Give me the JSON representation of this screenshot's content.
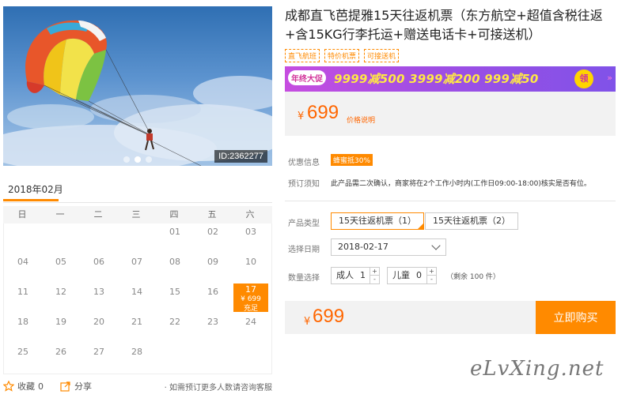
{
  "photo": {
    "id_tag": "ID:2362277",
    "carousel_count": 3,
    "carousel_active": 2
  },
  "calendar": {
    "month": "2018年02月",
    "weekdays": [
      "日",
      "一",
      "二",
      "三",
      "四",
      "五",
      "六"
    ],
    "rows": [
      [
        "",
        "",
        "",
        "",
        "01",
        "02",
        "03"
      ],
      [
        "04",
        "05",
        "06",
        "07",
        "08",
        "09",
        "10"
      ],
      [
        "11",
        "12",
        "13",
        "14",
        "15",
        "16",
        "17"
      ],
      [
        "18",
        "19",
        "20",
        "21",
        "22",
        "23",
        "24"
      ],
      [
        "25",
        "26",
        "27",
        "28",
        "",
        "",
        ""
      ]
    ],
    "selected": {
      "day": "17",
      "price": "¥ 699",
      "status": "充足"
    }
  },
  "bottom": {
    "favorite_label": "收藏",
    "favorite_count": "0",
    "share_label": "分享",
    "note": "· 如需预订更多人数请咨询客服"
  },
  "product": {
    "title": "成都直飞芭提雅15天往返机票（东方航空+超值含税往返+含15KG行李托运+赠送电话卡+可接送机）",
    "tags": [
      "直飞航班",
      "特价机票",
      "可接送机"
    ]
  },
  "promo": {
    "badge": "年终大促",
    "deals": "9999减500  3999减200  999减50",
    "claim": "领",
    "deco": "»"
  },
  "price": {
    "currency": "¥",
    "amount": "699",
    "explain": "价格说明"
  },
  "info": {
    "discount_label": "优惠信息",
    "discount_coupon": "蜂蜜抵30%",
    "booking_label": "预订须知",
    "booking_text": "此产品需二次确认，商家将在2个工作小时内(工作日09:00-18:00)核实是否有位。"
  },
  "form": {
    "type_label": "产品类型",
    "types": [
      "15天往返机票（1）",
      "15天往返机票（2）"
    ],
    "date_label": "选择日期",
    "date_value": "2018-02-17",
    "qty_label": "数量选择",
    "adult_label": "成人",
    "adult_value": "1",
    "child_label": "儿童",
    "child_value": "0",
    "plus": "+",
    "minus": "-",
    "remaining": "（剩余 100 件）"
  },
  "buy": {
    "currency": "¥",
    "amount": "699",
    "button": "立即购买"
  },
  "watermark": "eLvXing.net",
  "colors": {
    "accent": "#ff8a00",
    "price": "#ff6600"
  }
}
